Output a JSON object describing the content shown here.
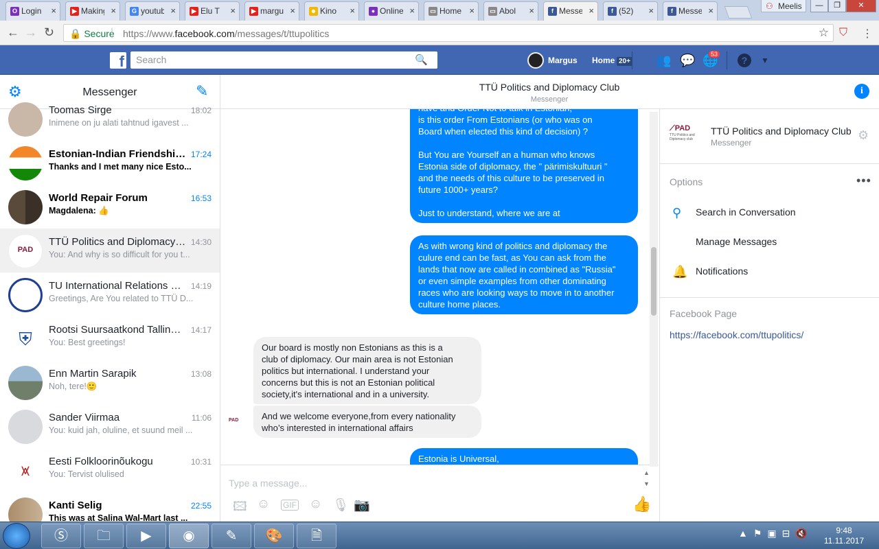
{
  "browser": {
    "tabs": [
      {
        "title": "Login",
        "fav_color": "#7b2fbe",
        "fav": "O"
      },
      {
        "title": "Making",
        "fav_color": "#e62117",
        "fav": "▶"
      },
      {
        "title": "youtube",
        "fav_color": "#4285f4",
        "fav": "G"
      },
      {
        "title": "Elu T",
        "fav_color": "#e62117",
        "fav": "▶"
      },
      {
        "title": "margus",
        "fav_color": "#e62117",
        "fav": "▶"
      },
      {
        "title": "Kino",
        "fav_color": "#f5b800",
        "fav": "☻"
      },
      {
        "title": "Online",
        "fav_color": "#7b2fbe",
        "fav": "●"
      },
      {
        "title": "Home",
        "fav_color": "#888888",
        "fav": "▭"
      },
      {
        "title": "Abol",
        "fav_color": "#888888",
        "fav": "▭"
      },
      {
        "title": "Messenger",
        "fav_color": "#3b5998",
        "fav": "f"
      },
      {
        "title": "(52)",
        "fav_color": "#3b5998",
        "fav": "f"
      },
      {
        "title": "Messenger",
        "fav_color": "#3b5998",
        "fav": "f"
      }
    ],
    "profile_name": "Meelis",
    "secure_label": "Secure",
    "url_prefix": "https://www.",
    "url_domain": "facebook.com",
    "url_path": "/messages/t/ttupolitics"
  },
  "fb": {
    "logo": "f",
    "search_placeholder": "Search",
    "user_name": "Margus",
    "home_label": "Home",
    "home_badge": "20+",
    "notif_badge": "53"
  },
  "sidebar": {
    "title": "Messenger",
    "conversations": [
      {
        "name": "Toomas Sirge",
        "preview": "Inimene on ju alati tahtnud igavest ...",
        "time": "18:02",
        "unread": false
      },
      {
        "name": "Estonian-Indian Friendship...",
        "preview": "Thanks and I met many nice Esto...",
        "time": "17:24",
        "unread": true
      },
      {
        "name": "World Repair Forum",
        "preview": "Magdalena: 👍",
        "time": "16:53",
        "unread": true
      },
      {
        "name": "TTÜ Politics and Diplomacy C...",
        "preview": "You: And why is so difficult for you t...",
        "time": "14:30",
        "unread": false
      },
      {
        "name": "TU International Relations So...",
        "preview": "Greetings, Are You related to TTÜ D...",
        "time": "14:19",
        "unread": false
      },
      {
        "name": "Rootsi Suursaatkond Tallinna...",
        "preview": "You: Best greetings!",
        "time": "14:17",
        "unread": false
      },
      {
        "name": "Enn Martin Sarapik",
        "preview": "Noh, tere!🙂",
        "time": "13:08",
        "unread": false
      },
      {
        "name": "Sander Viirmaa",
        "preview": "You: kuid jah, oluline, et suund meil ...",
        "time": "11:06",
        "unread": false
      },
      {
        "name": "Eesti Folkloorinõukogu",
        "preview": "You: Tervist olulised",
        "time": "10:31",
        "unread": false
      },
      {
        "name": "Kanti Selig",
        "preview": "This was at Salina Wal-Mart last ...",
        "time": "22:55",
        "unread": true
      }
    ]
  },
  "thread": {
    "title": "TTÜ Politics and Diplomacy Club",
    "subtitle": "Messenger",
    "messages": [
      {
        "dir": "out",
        "text": "have and Order Not to talk in Estonian,\nis this order From Estonians (or who was on\nBoard when elected this kind of decision) ?\n\nBut You are Yourself an a human who knows\nEstonia side of diplomacy, the \" pärimiskultuuri \"\nand the needs of this culture to be preserved in\nfuture 1000+ years?\n\nJust to understand, where we are at"
      },
      {
        "dir": "out",
        "text": "As with wrong kind of politics and diplomacy the\nculure end can be fast, as You can ask from the\nlands that now are called in combined as \"Russia\"\nor even simple examples from other dominating\nraces who are looking ways to move in to another\nculture home places."
      },
      {
        "dir": "in",
        "text": "Our board is mostly non Estonians as this is a\nclub of diplomacy. Our main area is not Estonian\npolitics but international. I understand your\nconcerns but this is not an Estonian political\nsociety,it's international and in a university."
      },
      {
        "dir": "in",
        "text": "And we welcome everyone,from every nationality\nwho’s interested in international affairs"
      },
      {
        "dir": "out",
        "text": "Estonia is Universal,"
      }
    ],
    "composer_placeholder": "Type a message..."
  },
  "details": {
    "name": "TTÜ Politics and Diplomacy Club",
    "subtitle": "Messenger",
    "logo_text": "PAD",
    "logo_sub": "TTU Politics and Diplomacy club",
    "options_label": "Options",
    "items": [
      "Search in Conversation",
      "Manage Messages",
      "Notifications"
    ],
    "page_label": "Facebook Page",
    "page_url": "https://facebook.com/ttupolitics/"
  },
  "taskbar": {
    "time": "9:48",
    "date": "11.11.2017"
  }
}
